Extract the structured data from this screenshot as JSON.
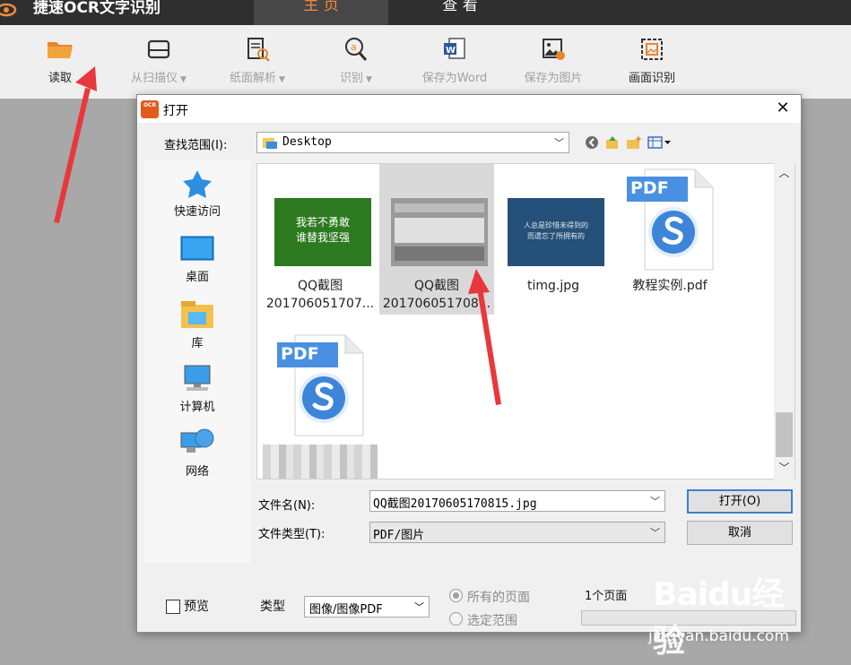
{
  "app": {
    "title": "捷速OCR文字识别",
    "tabs": [
      {
        "label": "主 页",
        "active": true
      },
      {
        "label": "查 看",
        "active": false
      }
    ],
    "accent_color": "#f08a3b"
  },
  "toolbar": {
    "items": [
      {
        "label": "读取",
        "icon": "folder-open-icon",
        "enabled": true,
        "has_dropdown": false
      },
      {
        "label": "从扫描仪",
        "icon": "scanner-icon",
        "enabled": false,
        "has_dropdown": true
      },
      {
        "label": "纸面解析",
        "icon": "document-analyze-icon",
        "enabled": false,
        "has_dropdown": true
      },
      {
        "label": "识别",
        "icon": "recognize-icon",
        "enabled": false,
        "has_dropdown": true
      },
      {
        "label": "保存为Word",
        "icon": "word-icon",
        "enabled": false,
        "has_dropdown": false
      },
      {
        "label": "保存为图片",
        "icon": "save-image-icon",
        "enabled": false,
        "has_dropdown": false
      },
      {
        "label": "画面识别",
        "icon": "screen-capture-icon",
        "enabled": true,
        "has_dropdown": false
      }
    ]
  },
  "dialog": {
    "icon_text": "OCR",
    "title": "打开",
    "look_in_label": "查找范围(I):",
    "look_in_value": "Desktop",
    "places": [
      {
        "label": "快速访问",
        "icon": "star-icon"
      },
      {
        "label": "桌面",
        "icon": "desktop-icon"
      },
      {
        "label": "库",
        "icon": "library-icon"
      },
      {
        "label": "计算机",
        "icon": "computer-icon"
      },
      {
        "label": "网络",
        "icon": "network-icon"
      }
    ],
    "files": [
      {
        "line1": "QQ截图",
        "line2": "201706051707...",
        "kind": "image",
        "selected": false,
        "thumb_text": [
          "我若不勇敢",
          "谁替我坚强"
        ]
      },
      {
        "line1": "QQ截图",
        "line2": "201706051708...",
        "kind": "image",
        "selected": true
      },
      {
        "line1": "timg.jpg",
        "line2": "",
        "kind": "image",
        "selected": false,
        "thumb_text": [
          "人总是珍惜未得到的",
          "而遗忘了所拥有的"
        ]
      },
      {
        "line1": "教程实例.pdf",
        "line2": "",
        "kind": "pdf",
        "selected": false
      },
      {
        "line1": "",
        "line2": "",
        "kind": "pdf",
        "selected": false
      }
    ],
    "pdf_badge": "PDF",
    "filename_label": "文件名(N):",
    "filename_value": "QQ截图20170605170815.jpg",
    "filetype_label": "文件类型(T):",
    "filetype_value": "PDF/图片",
    "open_button": "打开(O)",
    "cancel_button": "取消",
    "preview_label": "预览",
    "type_label": "类型",
    "type_value": "图像/图像PDF",
    "all_pages_label": "所有的页面",
    "selected_range_label": "选定范围",
    "pages_count": "1个页面"
  },
  "watermark": {
    "logo": "Baidu经验",
    "site": "jingyan.baidu.com"
  }
}
